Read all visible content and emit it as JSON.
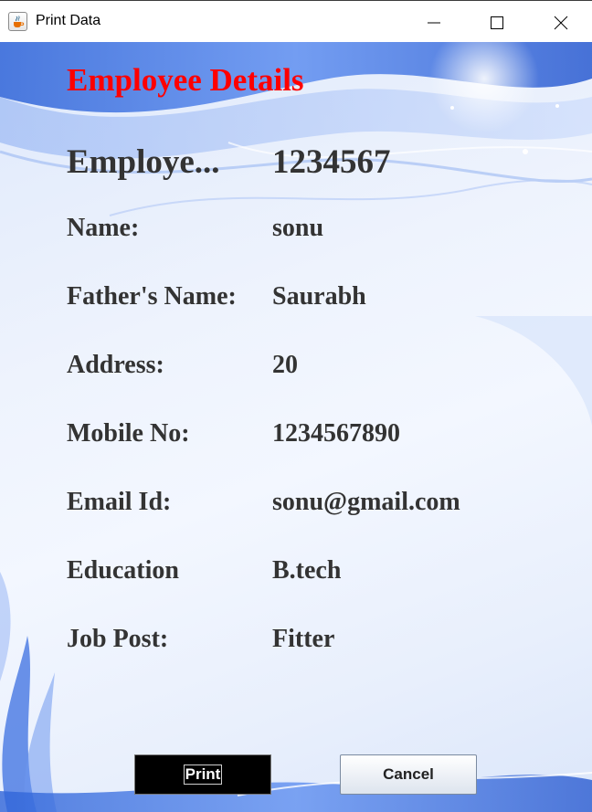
{
  "window": {
    "title": "Print Data"
  },
  "heading": "Employee Details",
  "employee_id": {
    "label": "Employe...",
    "value": "1234567"
  },
  "fields": [
    {
      "label": "Name:",
      "value": "sonu"
    },
    {
      "label": "Father's Name:",
      "value": "Saurabh"
    },
    {
      "label": "Address:",
      "value": "20"
    },
    {
      "label": "Mobile No:",
      "value": "1234567890"
    },
    {
      "label": "Email Id:",
      "value": "sonu@gmail.com"
    },
    {
      "label": "Education",
      "value": "B.tech"
    },
    {
      "label": "Job Post:",
      "value": "Fitter"
    }
  ],
  "buttons": {
    "print": "Print",
    "cancel": "Cancel"
  },
  "colors": {
    "heading": "#ff0000",
    "text": "#333333",
    "print_button_bg": "#000000"
  },
  "icons": {
    "app": "java-cup-icon",
    "minimize": "minimize-icon",
    "maximize": "maximize-icon",
    "close": "close-icon"
  }
}
